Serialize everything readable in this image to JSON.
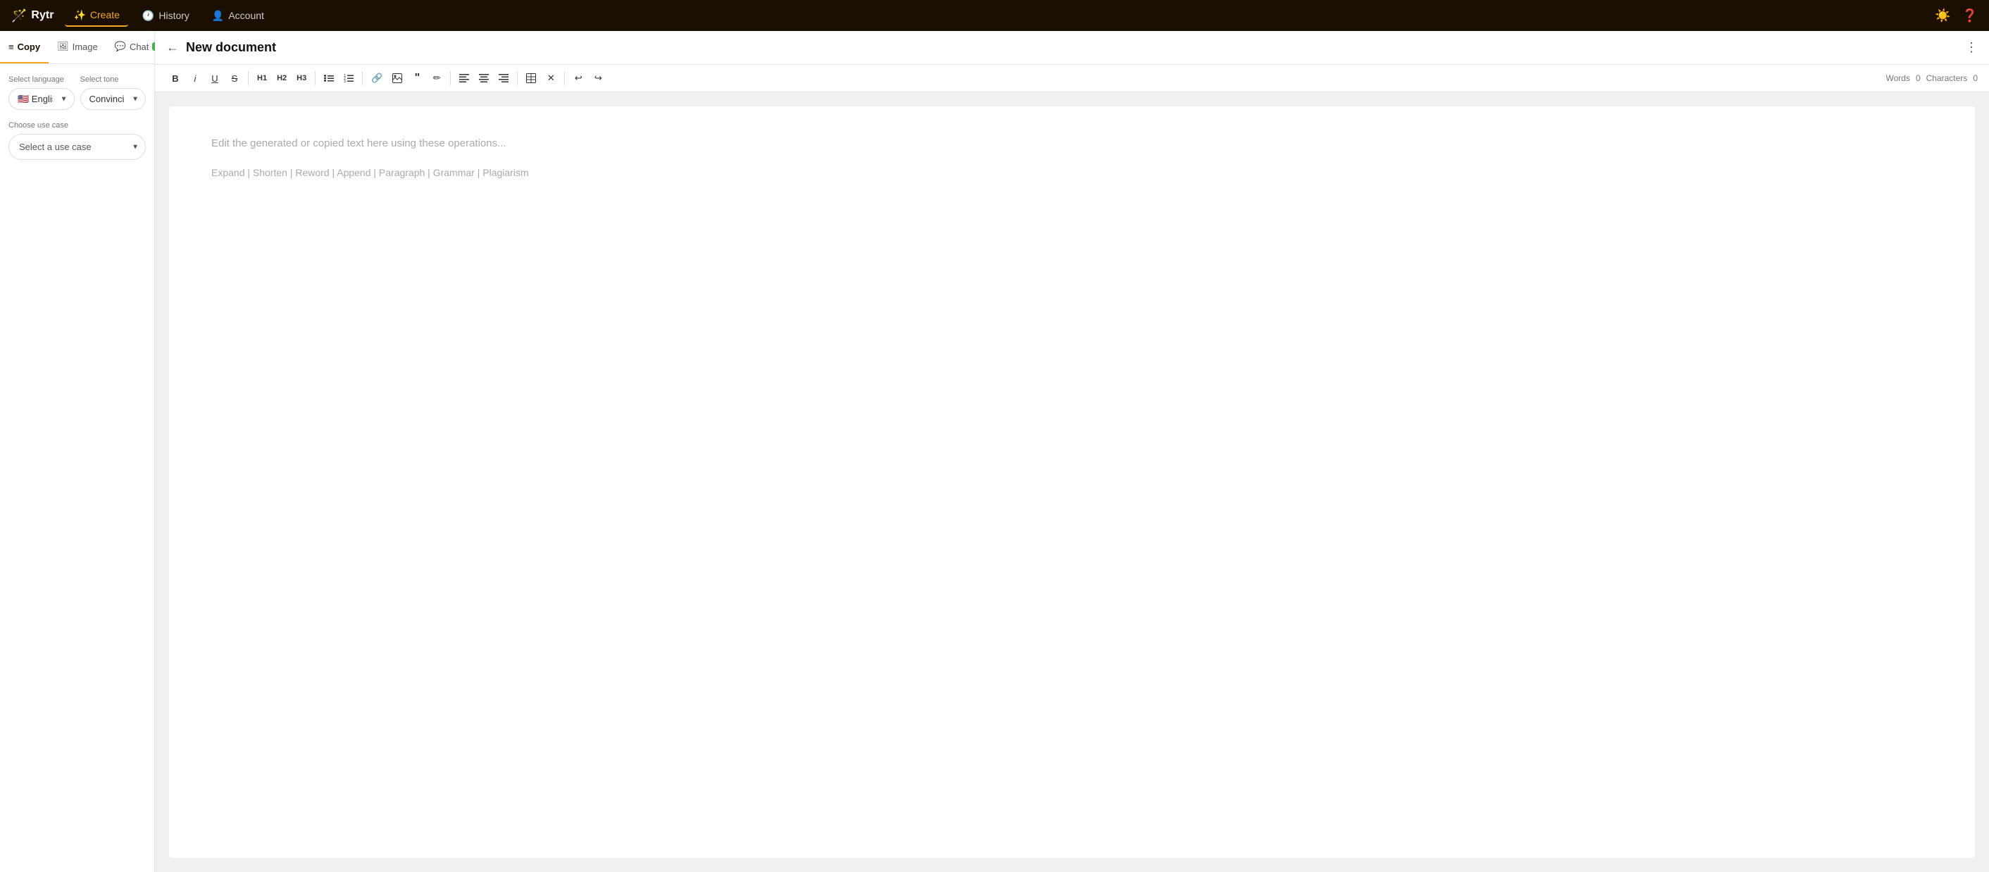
{
  "navbar": {
    "brand": "Rytr",
    "brand_icon": "🪄",
    "items": [
      {
        "id": "create",
        "icon": "✨",
        "label": "Create",
        "active": true
      },
      {
        "id": "history",
        "icon": "🕐",
        "label": "History",
        "active": false
      },
      {
        "id": "account",
        "icon": "👤",
        "label": "Account",
        "active": false
      }
    ]
  },
  "sidebar": {
    "tabs": [
      {
        "id": "copy",
        "icon": "≡",
        "label": "Copy",
        "active": true,
        "badge": null
      },
      {
        "id": "image",
        "icon": "🖼",
        "label": "Image",
        "active": false,
        "badge": null
      },
      {
        "id": "chat",
        "icon": "💬",
        "label": "Chat",
        "active": false,
        "badge": "new"
      }
    ],
    "language_label": "Select language",
    "language_value": "🇺🇸 English",
    "tone_label": "Select tone",
    "tone_value": "Convincing",
    "use_case_label": "Choose use case",
    "use_case_placeholder": "Select a use case"
  },
  "editor": {
    "back_icon": "←",
    "title": "New document",
    "more_icon": "⋮",
    "toolbar": {
      "bold": "B",
      "italic": "i",
      "underline": "U",
      "strike": "S",
      "h1": "H1",
      "h2": "H2",
      "h3": "H3",
      "ul": "≡",
      "ol": "#",
      "link": "🔗",
      "image": "🖼",
      "quote": "❝",
      "highlight": "✏",
      "align_left": "≡",
      "align_center": "≡",
      "align_right": "≡",
      "table": "⊞",
      "clear": "✕",
      "undo": "↩",
      "redo": "↪"
    },
    "words_label": "Words",
    "words_count": "0",
    "chars_label": "Characters",
    "chars_count": "0",
    "placeholder": "Edit the generated or copied text here using these operations...",
    "operations": "Expand | Shorten | Reword | Append | Paragraph | Grammar | Plagiarism"
  }
}
